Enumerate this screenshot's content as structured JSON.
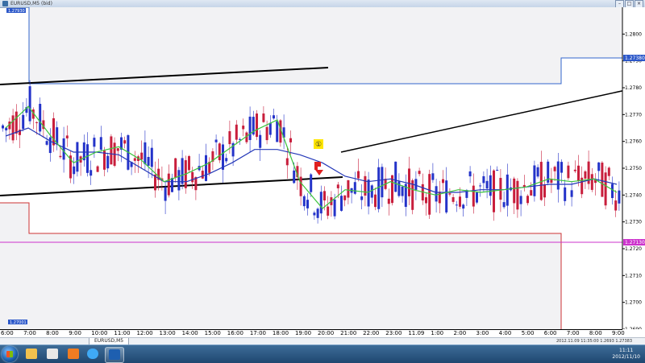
{
  "window": {
    "title": "EURUSD,M5 (bid)"
  },
  "chart": {
    "price_labels": [
      "1.2800",
      "1.2790",
      "1.2780",
      "1.2770",
      "1.2760",
      "1.2750",
      "1.2740",
      "1.2730",
      "1.2720",
      "1.2710",
      "1.2700",
      "1.2690"
    ],
    "current_price": "1.27380",
    "level_label": "1.27130",
    "time_labels": [
      "6:00",
      "7:00",
      "8:00",
      "9:00",
      "10:00",
      "11:00",
      "12:00",
      "13:00",
      "14:00",
      "15:00",
      "16:00",
      "17:00",
      "18:00",
      "19:00",
      "20:00",
      "21:00",
      "22:00",
      "23:00",
      "11.09",
      "1:00",
      "2:00",
      "3:00",
      "4:00",
      "5:00",
      "6:00",
      "7:00",
      "8:00",
      "9:00"
    ],
    "annotation_marker": "①",
    "zone_label_top": "1.27930",
    "zone_label_bottom": "1.27001"
  },
  "chart_data": {
    "type": "line",
    "title": "EURUSD,M5 (bid)",
    "series": [
      {
        "name": "",
        "color": "#2438b8",
        "values": [
          1.2762,
          1.2765,
          1.276,
          1.2756,
          1.2756,
          1.2755,
          1.275,
          1.2745,
          1.2745,
          1.2748,
          1.2752,
          1.2757,
          1.2757,
          1.2755,
          1.2752,
          1.2747,
          1.2745,
          1.2746,
          1.2744,
          1.2741,
          1.2741,
          1.2742,
          1.2742,
          1.2743,
          1.2744,
          1.2744,
          1.2746,
          1.2744
        ]
      },
      {
        "name": "",
        "color": "#3cc43c",
        "values": [
          1.2765,
          1.2773,
          1.2762,
          1.2752,
          1.2756,
          1.2758,
          1.2753,
          1.2745,
          1.2748,
          1.2752,
          1.2758,
          1.2764,
          1.2768,
          1.2745,
          1.2735,
          1.2742,
          1.2741,
          1.2745,
          1.2742,
          1.274,
          1.2742,
          1.2741,
          1.2742,
          1.2743,
          1.2746,
          1.2745,
          1.2746,
          1.2741
        ]
      }
    ],
    "x": [
      "6:00",
      "7:00",
      "8:00",
      "9:00",
      "10:00",
      "11:00",
      "12:00",
      "13:00",
      "14:00",
      "15:00",
      "16:00",
      "17:00",
      "18:00",
      "19:00",
      "20:00",
      "21:00",
      "22:00",
      "23:00",
      "11.09",
      "1:00",
      "2:00",
      "3:00",
      "4:00",
      "5:00",
      "6:00",
      "7:00",
      "8:00",
      "9:00"
    ],
    "ylim": [
      1.269,
      1.281
    ],
    "grid": false
  },
  "tabbar": {
    "tab": "EURUSD,M5",
    "status": "2012.11.09 11:35:00  1.2693  1.27383"
  },
  "taskbar": {
    "time": "11:11",
    "date": "2012/11/10"
  },
  "colors": {
    "bull": "#2433c9",
    "bear": "#c81e3c",
    "zone_bg": "#f2f2f4",
    "zone_top_border": "#3366cc",
    "zone_bottom_border": "#cc3333",
    "level_line": "#cc33cc"
  }
}
